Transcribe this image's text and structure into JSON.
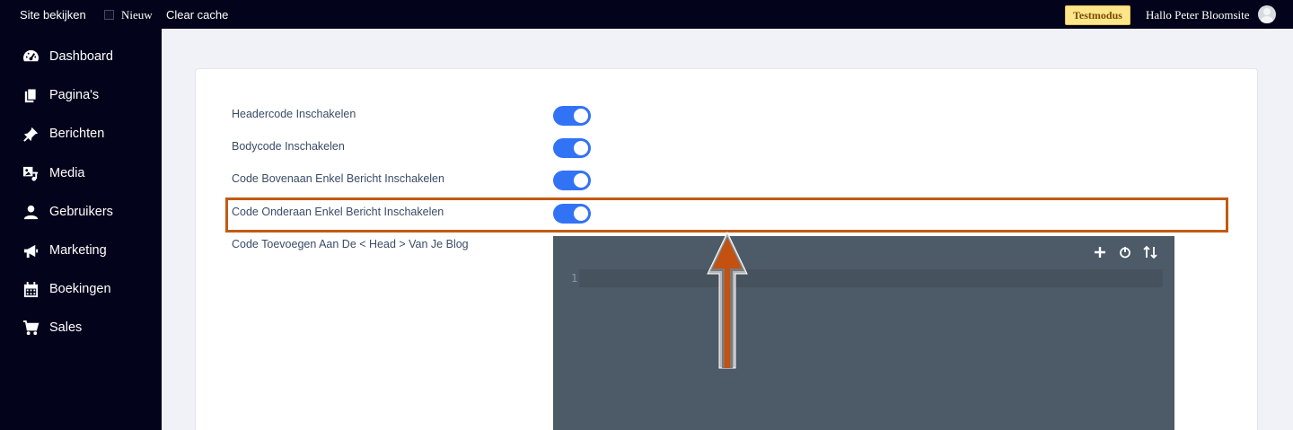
{
  "topbar": {
    "site_label": "Site bekijken",
    "new_label": "Nieuw",
    "cache_label": "Clear cache",
    "testmode_badge": "Testmodus",
    "greeting": "Hallo Peter Bloomsite"
  },
  "sidebar": {
    "items": [
      {
        "label": "Dashboard",
        "icon": "dashboard-icon"
      },
      {
        "label": "Pagina's",
        "icon": "pages-icon"
      },
      {
        "label": "Berichten",
        "icon": "pin-icon"
      },
      {
        "label": "Media",
        "icon": "media-icon"
      },
      {
        "label": "Gebruikers",
        "icon": "user-icon"
      },
      {
        "label": "Marketing",
        "icon": "megaphone-icon"
      },
      {
        "label": "Boekingen",
        "icon": "calendar-icon"
      },
      {
        "label": "Sales",
        "icon": "cart-icon"
      }
    ]
  },
  "settings": {
    "rows": [
      {
        "label": "Headercode Inschakelen",
        "enabled": true
      },
      {
        "label": "Bodycode Inschakelen",
        "enabled": true
      },
      {
        "label": "Code Bovenaan Enkel Bericht Inschakelen",
        "enabled": true
      },
      {
        "label": "Code Onderaan Enkel Bericht Inschakelen",
        "enabled": true
      }
    ],
    "head_code_label": "Code Toevoegen Aan De < Head > Van Je Blog"
  },
  "editor": {
    "line_number": "1",
    "buttons": [
      "plus-icon",
      "power-icon",
      "sort-icon"
    ]
  },
  "colors": {
    "accent": "#3273f6",
    "highlight": "#c25a12",
    "sidebar_bg": "#03041b",
    "editor_bg": "#4d5a67"
  }
}
